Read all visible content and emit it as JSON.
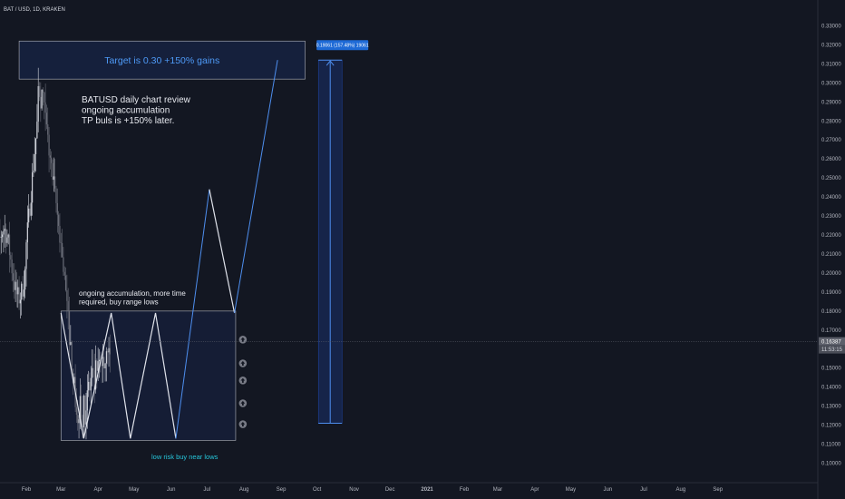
{
  "chart_data": {
    "type": "line",
    "symbol_label": "BAT / USD, 1D, KRAKEN",
    "y_axis": {
      "ticks": [
        "0.33000",
        "0.32000",
        "0.31000",
        "0.30000",
        "0.29000",
        "0.28000",
        "0.27000",
        "0.26000",
        "0.25000",
        "0.24000",
        "0.23000",
        "0.22000",
        "0.21000",
        "0.20000",
        "0.19000",
        "0.18000",
        "0.17000",
        "0.16000",
        "0.15000",
        "0.14000",
        "0.13000",
        "0.12000",
        "0.11000",
        "0.10000"
      ],
      "ylim": [
        0.095,
        0.335
      ]
    },
    "x_axis": {
      "ticks": [
        "Feb",
        "Mar",
        "Apr",
        "May",
        "Jun",
        "Jul",
        "Aug",
        "Sep",
        "Oct",
        "Nov",
        "Dec",
        "2021",
        "Feb",
        "Mar",
        "Apr",
        "May",
        "Jun",
        "Jul",
        "Aug",
        "Sep"
      ],
      "ticks_bold": [
        false,
        false,
        false,
        false,
        false,
        false,
        false,
        false,
        false,
        false,
        false,
        true,
        false,
        false,
        false,
        false,
        false,
        false,
        false,
        false
      ]
    },
    "current_price": "0.16387",
    "countdown": "11:53:15",
    "projection_label": "0.19061 (157.48%) 19061",
    "projection_path": [
      {
        "x": "2020-03-01",
        "y": 0.179
      },
      {
        "x": "2020-03-20",
        "y": 0.113
      },
      {
        "x": "2020-04-12",
        "y": 0.179
      },
      {
        "x": "2020-04-28",
        "y": 0.113
      },
      {
        "x": "2020-05-19",
        "y": 0.179
      },
      {
        "x": "2020-06-05",
        "y": 0.113
      },
      {
        "x": "2020-07-03",
        "y": 0.244
      },
      {
        "x": "2020-07-24",
        "y": 0.179
      },
      {
        "x": "2020-08-29",
        "y": 0.312
      }
    ],
    "range_box": {
      "x0": "2020-03-01",
      "x1": "2020-07-25",
      "y0": 0.112,
      "y1": 0.18
    },
    "target_box": {
      "x0": "2020-01-26",
      "x1": "2020-09-21",
      "y0": 0.302,
      "y1": 0.322
    },
    "measure_bar": {
      "x": "2020-10-12",
      "y0": 0.121,
      "y1": 0.312
    },
    "arrow_markers": [
      0.165,
      0.1525,
      0.1435,
      0.1315,
      0.1205
    ],
    "annotations": {
      "target": "Target is 0.30 +150% gains",
      "review_lines": [
        "BATUSD daily chart review",
        "ongoing accumulation",
        "TP buls is +150% later."
      ],
      "accum_lines": [
        "ongoing accumulation, more time",
        "required, buy range lows"
      ],
      "low_risk": "low risk buy near lows"
    },
    "colors": {
      "background": "#131722",
      "up": "#d1d4dc",
      "down": "#6a6d78",
      "projection_white": "#e0e3eb",
      "projection_blue": "#4e8ff0",
      "target_text": "#4e9af7",
      "low_risk_text": "#26c6da",
      "label_bg": "#2962ff"
    },
    "grid": false
  }
}
